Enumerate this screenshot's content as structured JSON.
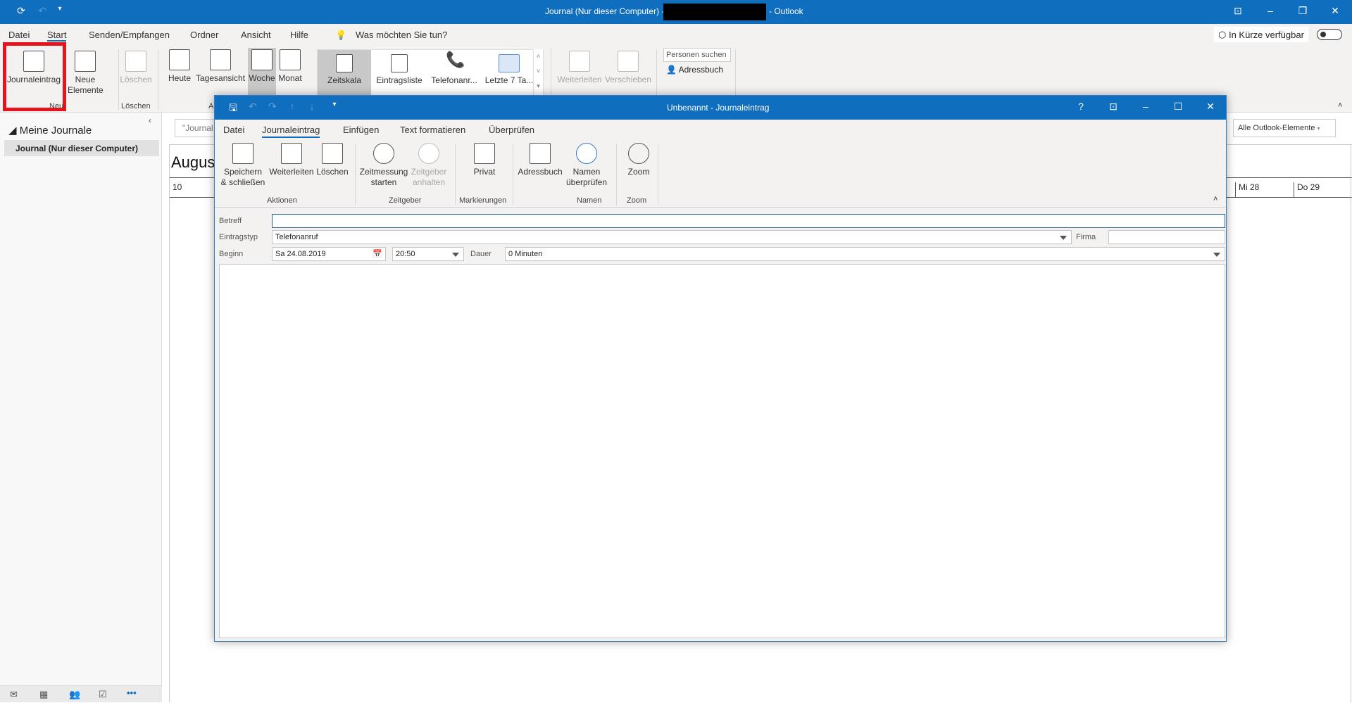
{
  "window": {
    "title_prefix": "Journal (Nur dieser Computer) -",
    "title_suffix": "- Outlook"
  },
  "menu": [
    "Datei",
    "Start",
    "Senden/Empfangen",
    "Ordner",
    "Ansicht",
    "Hilfe"
  ],
  "tell_me": "Was möchten Sie tun?",
  "coming_soon": "In Kürze verfügbar",
  "ribbon": {
    "journal_entry": "Journaleintrag",
    "new_items": "Neue Elemente",
    "group_new": "Neu",
    "delete": "Löschen",
    "group_delete": "Löschen",
    "today": "Heute",
    "day_view": "Tagesansicht",
    "week": "Woche",
    "month": "Monat",
    "group_arrange": "A",
    "views": [
      "Zeitskala",
      "Eintragsliste",
      "Telefonanr...",
      "Letzte 7 Ta..."
    ],
    "forward": "Weiterleiten",
    "move": "Verschieben",
    "search_people": "Personen suchen",
    "address_book": "Adressbuch"
  },
  "sidebar": {
    "group": "Meine Journale",
    "item": "Journal (Nur dieser Computer)"
  },
  "main": {
    "search_placeholder": "\"Journal",
    "scope": "Alle Outlook-Elemente",
    "month": "August",
    "days": [
      "10",
      "Mi 28",
      "Do 29"
    ]
  },
  "dialog": {
    "title": "Unbenannt - Journaleintrag",
    "tabs": [
      "Datei",
      "Journaleintrag",
      "Einfügen",
      "Text formatieren",
      "Überprüfen"
    ],
    "buttons": {
      "save_close": "Speichern & schließen",
      "forward": "Weiterleiten",
      "delete": "Löschen",
      "start_timer": "Zeitmessung starten",
      "pause_timer": "Zeitgeber anhalten",
      "private": "Privat",
      "address_book": "Adressbuch",
      "check_names": "Namen überprüfen",
      "zoom": "Zoom"
    },
    "groups": [
      "Aktionen",
      "Zeitgeber",
      "Markierungen",
      "Namen",
      "Zoom"
    ],
    "form": {
      "subject_label": "Betreff",
      "subject": "",
      "type_label": "Eintragstyp",
      "type": "Telefonanruf",
      "company_label": "Firma",
      "company": "",
      "start_label": "Beginn",
      "start_date": "Sa 24.08.2019",
      "start_time": "20:50",
      "duration_label": "Dauer",
      "duration": "0 Minuten"
    }
  }
}
